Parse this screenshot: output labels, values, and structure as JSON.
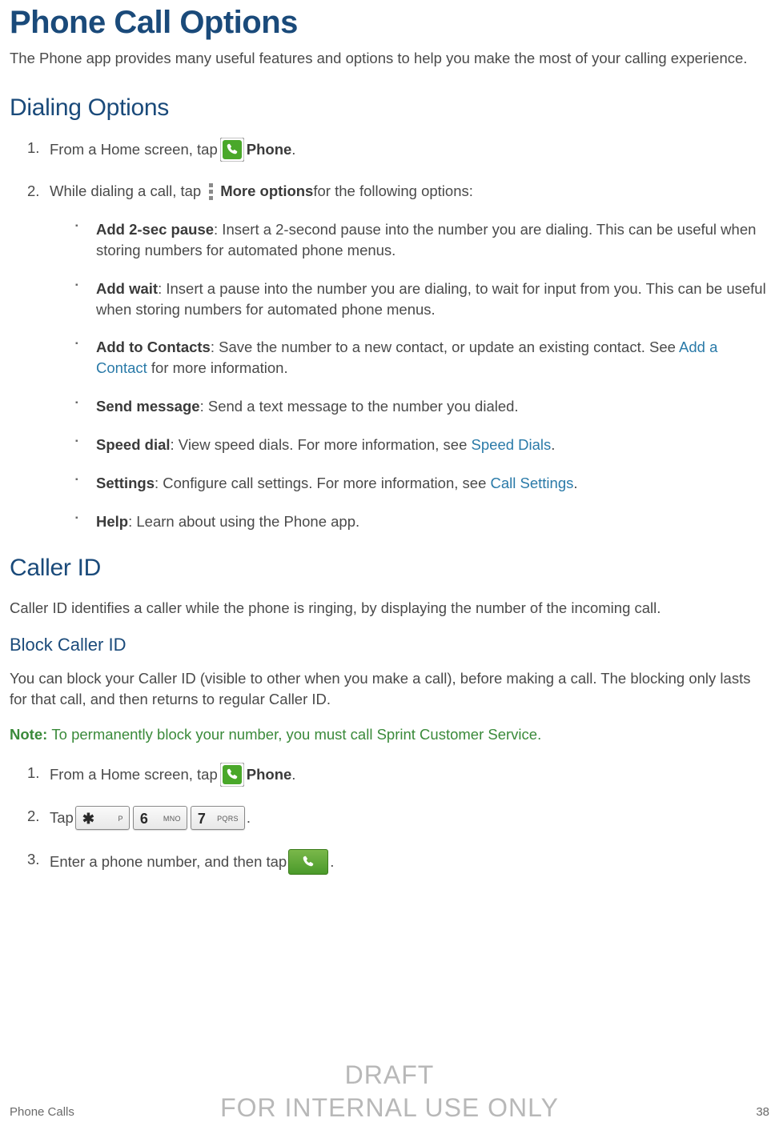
{
  "title": "Phone Call Options",
  "intro": "The Phone app provides many useful features and options to help you make the most of your calling experience.",
  "dialing": {
    "heading": "Dialing Options",
    "step1_pre": "From a Home screen, tap ",
    "step1_post": " Phone",
    "step1_end": ".",
    "step2_pre": "While dialing a call, tap ",
    "step2_bold": " More options",
    "step2_post": " for the following options:",
    "bullets": [
      {
        "b": "Add 2-sec pause",
        "t": ": Insert a 2-second pause into the number you are dialing. This can be useful when storing numbers for automated phone menus."
      },
      {
        "b": "Add wait",
        "t": ": Insert a pause into the number you are dialing, to wait for input from you. This can be useful when storing numbers for automated phone menus."
      },
      {
        "b": "Add to Contacts",
        "t1": ": Save the number to a new contact, or update an existing contact. See ",
        "link": "Add a Contact",
        "t2": " for more information."
      },
      {
        "b": "Send message",
        "t": ": Send a text message to the number you dialed."
      },
      {
        "b": "Speed dial",
        "t1": ": View speed dials. For more information, see ",
        "link": "Speed Dials",
        "t2": "."
      },
      {
        "b": "Settings",
        "t1": ": Configure call settings. For more information, see ",
        "link": "Call Settings",
        "t2": "."
      },
      {
        "b": "Help",
        "t": ": Learn about using the Phone app."
      }
    ]
  },
  "callerid": {
    "heading": "Caller ID",
    "intro": "Caller ID identifies a caller while the phone is ringing, by displaying the number of the incoming call.",
    "block_heading": "Block Caller ID",
    "block_para": "You can block your Caller ID (visible to other when you make a call), before making a call. The blocking only lasts for that call, and then returns to regular Caller ID.",
    "note_label": "Note: ",
    "note_body": "To permanently block your number, you must call Sprint Customer Service.",
    "step1_pre": "From a Home screen, tap ",
    "step1_post": " Phone",
    "step1_end": ".",
    "step2_pre": "Tap ",
    "step2_end": ".",
    "step3_pre": "Enter a phone number, and then tap ",
    "step3_end": ".",
    "keys": [
      {
        "main": "✱",
        "sub": "P"
      },
      {
        "main": "6",
        "sub": "MNO"
      },
      {
        "main": "7",
        "sub": "PQRS"
      }
    ]
  },
  "footer": {
    "left": "Phone Calls",
    "right": "38"
  },
  "watermark": {
    "line1": "DRAFT",
    "line2": "FOR INTERNAL USE ONLY"
  }
}
